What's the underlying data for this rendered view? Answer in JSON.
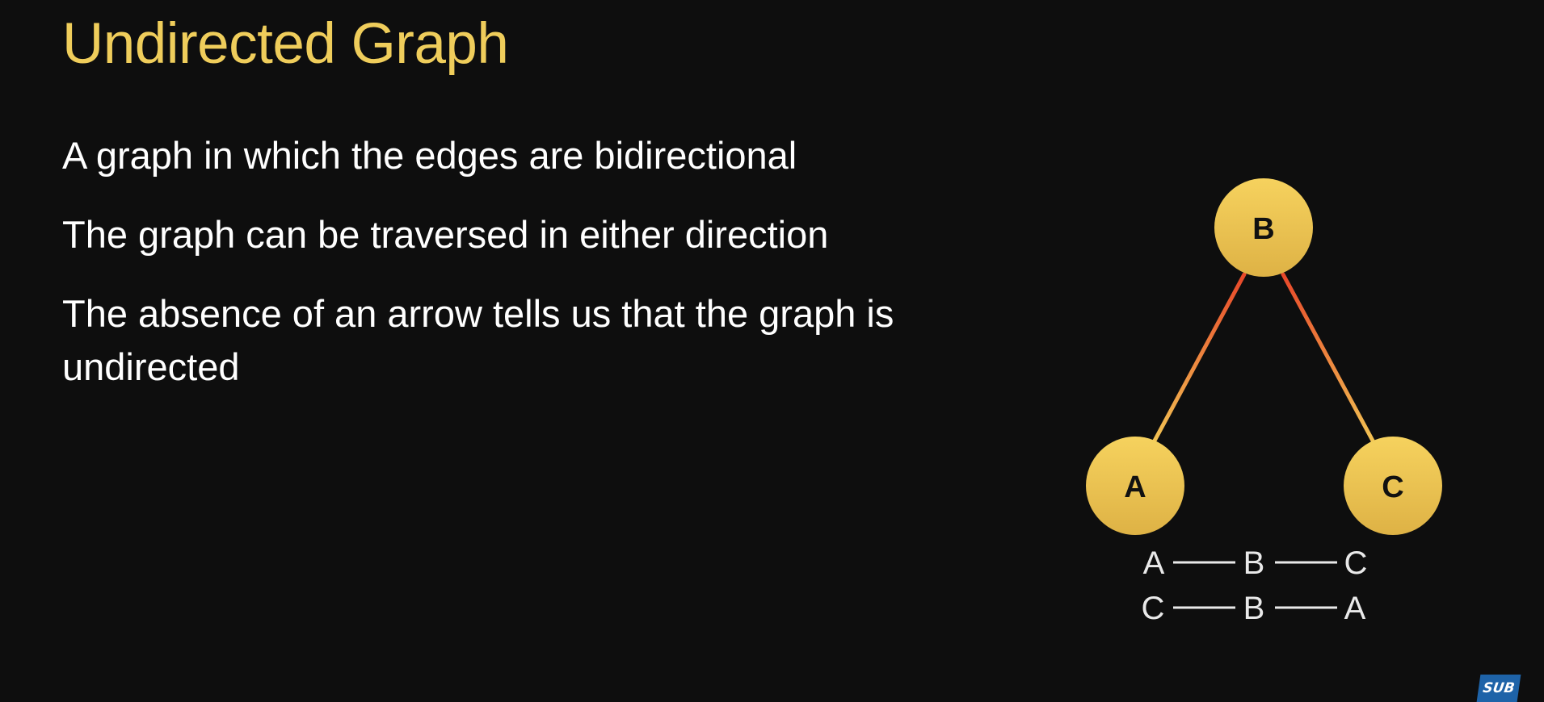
{
  "title": "Undirected Graph",
  "bullets": [
    "A graph in which the edges are bidirectional",
    "The graph can be traversed in either direction",
    "The absence of an arrow tells us that the graph is undirected"
  ],
  "diagram": {
    "nodes": [
      "B",
      "A",
      "C"
    ],
    "edges": [
      [
        "A",
        "B"
      ],
      [
        "B",
        "C"
      ]
    ],
    "traversals": [
      [
        "A",
        "B",
        "C"
      ],
      [
        "C",
        "B",
        "A"
      ]
    ],
    "colors": {
      "node_fill_top": "#f6d25e",
      "node_fill_bottom": "#deb245",
      "edge_top": "#e8482a",
      "edge_bottom": "#f2c353"
    }
  },
  "badge": "SUB"
}
